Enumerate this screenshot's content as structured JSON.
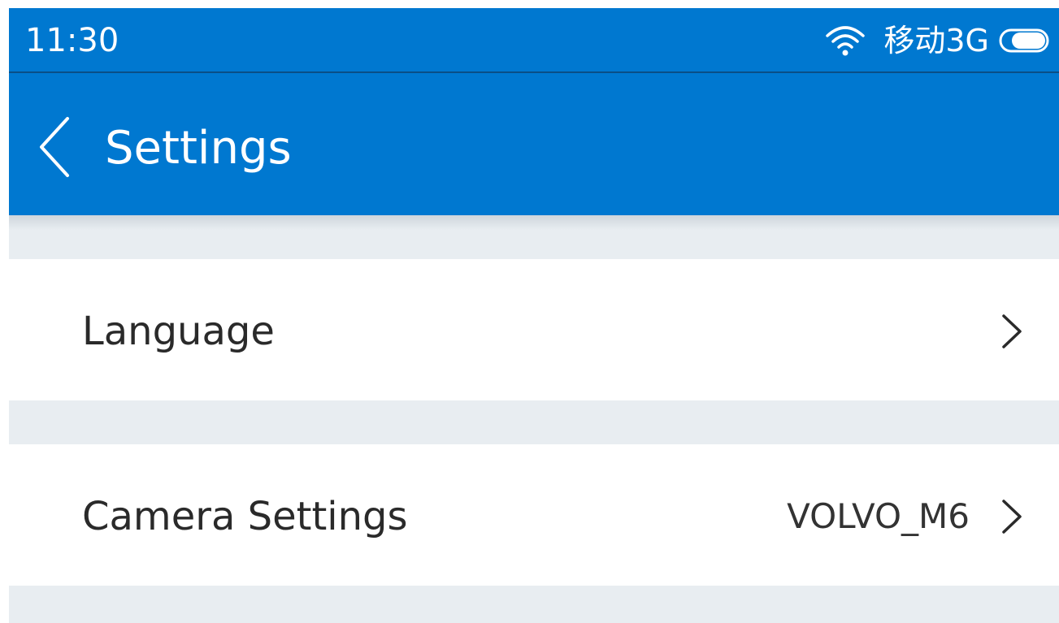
{
  "status_bar": {
    "time": "11:30",
    "carrier": "移动3G",
    "icons": [
      "wifi-icon",
      "battery-icon"
    ]
  },
  "app_bar": {
    "title": "Settings",
    "back_icon": "back-chevron-icon"
  },
  "settings": {
    "items": [
      {
        "label": "Language",
        "value": "",
        "icon": "chevron-right-icon"
      },
      {
        "label": "Camera Settings",
        "value": "VOLVO_M6",
        "icon": "chevron-right-icon"
      }
    ]
  },
  "colors": {
    "primary": "#0078d0",
    "background": "#e8edf1",
    "row": "#ffffff",
    "text": "#2a2a2a"
  }
}
